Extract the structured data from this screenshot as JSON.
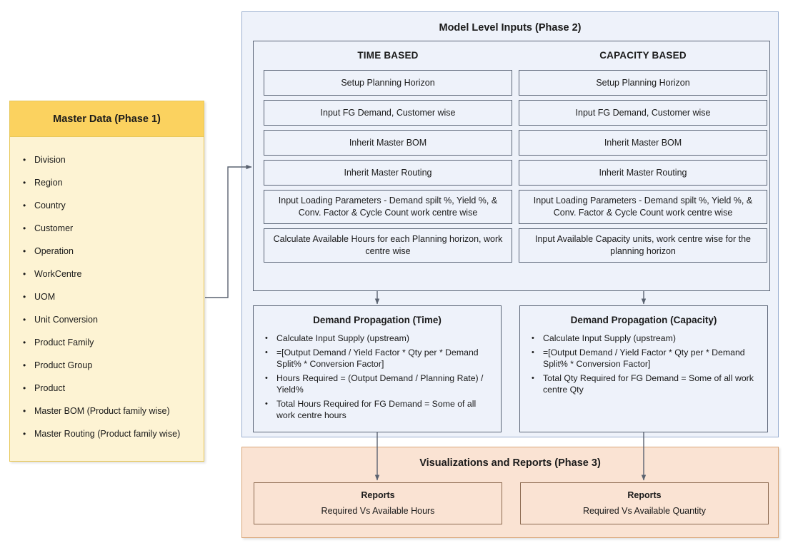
{
  "master_data": {
    "title": "Master Data (Phase 1)",
    "items": [
      "Division",
      "Region",
      "Country",
      "Customer",
      "Operation",
      "WorkCentre",
      "UOM",
      "Unit Conversion",
      "Product Family",
      "Product Group",
      "Product",
      "Master BOM (Product family wise)",
      "Master Routing (Product family wise)"
    ]
  },
  "phase2": {
    "title": "Model  Level Inputs (Phase 2)",
    "columns": [
      {
        "heading": "TIME BASED",
        "steps": [
          "Setup Planning Horizon",
          "Input FG Demand,  Customer wise",
          "Inherit Master BOM",
          "Inherit Master Routing",
          "Input Loading Parameters - Demand  spilt %, Yield %, & Conv.  Factor & Cycle Count work centre wise",
          "Calculate Available Hours for each Planning horizon, work centre wise"
        ]
      },
      {
        "heading": "CAPACITY BASED",
        "steps": [
          "Setup Planning Horizon",
          "Input FG Demand,  Customer wise",
          "Inherit Master BOM",
          "Inherit Master Routing",
          "Input Loading Parameters - Demand  spilt %, Yield %, & Conv.  Factor & Cycle Count work centre wise",
          "Input Available Capacity units, work centre wise for the planning horizon"
        ]
      }
    ],
    "demand_propagation": [
      {
        "title": "Demand Propagation (Time)",
        "bullets": [
          "Calculate Input Supply (upstream)",
          "=[Output Demand  / Yield Factor * Qty per * Demand Split% * Conversion  Factor]",
          "Hours Required  = (Output Demand  / Planning Rate) / Yield%",
          "Total Hours Required  for FG Demand  = Some of all work centre hours"
        ]
      },
      {
        "title": "Demand Propagation (Capacity)",
        "bullets": [
          "Calculate Input Supply (upstream)",
          "=[Output Demand  / Yield Factor * Qty per * Demand Split% * Conversion  Factor]",
          "Total Qty Required  for FG Demand  = Some of all work centre Qty"
        ]
      }
    ]
  },
  "phase3": {
    "title": "Visualizations and Reports (Phase 3)",
    "reports": [
      {
        "title": "Reports",
        "subtitle": "Required Vs Available  Hours"
      },
      {
        "title": "Reports",
        "subtitle": "Required Vs Available  Quantity"
      }
    ]
  },
  "colors": {
    "master_header": "#fbd25f",
    "master_body": "#fdf3d3",
    "phase2_bg": "#eef2fa",
    "phase2_border": "#9aafd0",
    "box_border": "#5b6577",
    "phase3_bg": "#fae3d3",
    "phase3_border": "#d9a679",
    "report_border": "#8c6a50",
    "connector": "#5a6270"
  }
}
